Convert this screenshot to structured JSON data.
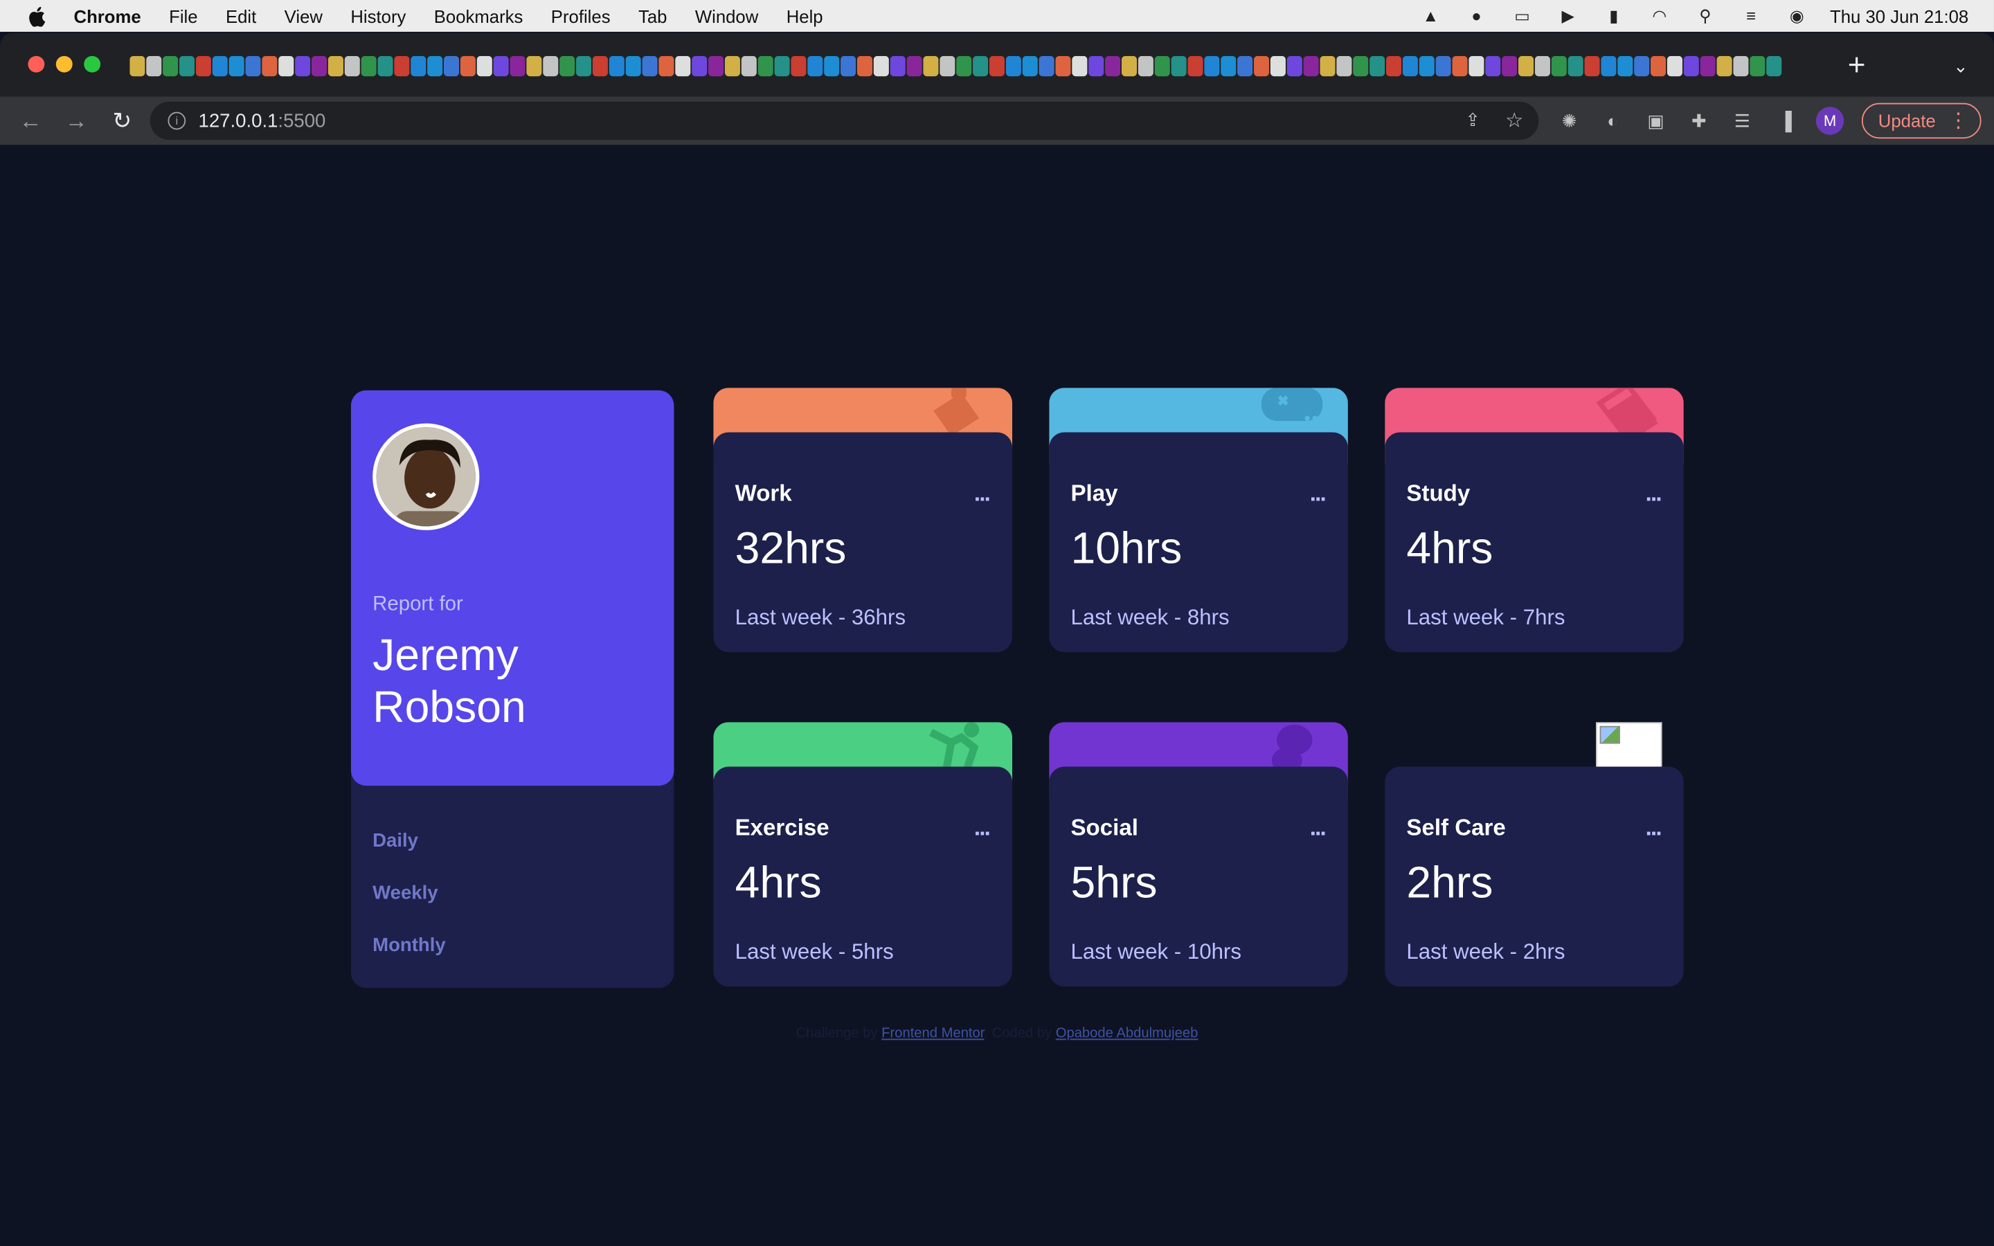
{
  "menubar": {
    "app": "Chrome",
    "items": [
      "File",
      "Edit",
      "View",
      "History",
      "Bookmarks",
      "Profiles",
      "Tab",
      "Window",
      "Help"
    ],
    "clock": "Thu 30 Jun  21:08"
  },
  "browser": {
    "url_host": "127.0.0.1",
    "url_port": ":5500",
    "update_label": "Update",
    "profile_initial": "M"
  },
  "profile": {
    "report_for": "Report for",
    "name": "Jeremy Robson",
    "timeframes": [
      "Daily",
      "Weekly",
      "Monthly"
    ]
  },
  "cards": [
    {
      "title": "Work",
      "hours": "32hrs",
      "previous": "Last week - 36hrs",
      "color": "#f1875e",
      "icon": "briefcase-icon"
    },
    {
      "title": "Play",
      "hours": "10hrs",
      "previous": "Last week - 8hrs",
      "color": "#55b8e0",
      "icon": "gamepad-icon"
    },
    {
      "title": "Study",
      "hours": "4hrs",
      "previous": "Last week - 7hrs",
      "color": "#f15a80",
      "icon": "book-icon"
    },
    {
      "title": "Exercise",
      "hours": "4hrs",
      "previous": "Last week - 5hrs",
      "color": "#4bcf83",
      "icon": "running-icon"
    },
    {
      "title": "Social",
      "hours": "5hrs",
      "previous": "Last week - 10hrs",
      "color": "#7335d2",
      "icon": "balloon-icon"
    },
    {
      "title": "Self Care",
      "hours": "2hrs",
      "previous": "Last week - 2hrs",
      "color": "#f1c75b",
      "icon": "broken-image-icon"
    }
  ],
  "attribution": {
    "prefix": "Challenge by",
    "link1": "Frontend Mentor",
    "middle": ". Coded by",
    "link2": "Opabode Abdulmujeeb"
  },
  "colors": {
    "page_bg": "#0e1323",
    "card_bg": "#1d204b",
    "profile_bg": "#5746ea",
    "muted_text": "#bbc0ff"
  },
  "card_more_label": "..."
}
